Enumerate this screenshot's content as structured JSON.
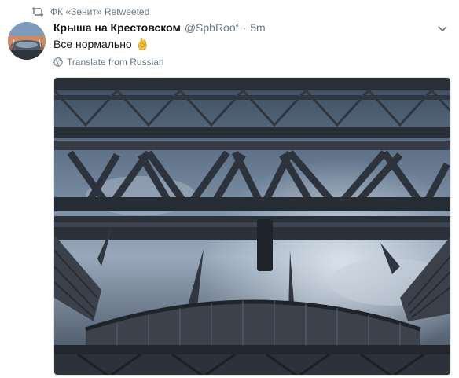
{
  "retweet": {
    "icon": "retweet-icon",
    "text": "ФК «Зенит» Retweeted"
  },
  "tweet": {
    "avatar_icon": "stadium-avatar",
    "display_name": "Крыша на Крестовском",
    "handle": "@SpbRoof",
    "separator": "·",
    "time": "5m",
    "text": "Все нормально",
    "emoji": "ok-hand-emoji",
    "translate_label": "Translate from Russian",
    "more_icon": "chevron-down-icon"
  },
  "media": {
    "description_icon": "stadium-roof-photo"
  },
  "colors": {
    "secondary_text": "#657786",
    "primary_text": "#14171a",
    "border": "#e1e8ed"
  }
}
